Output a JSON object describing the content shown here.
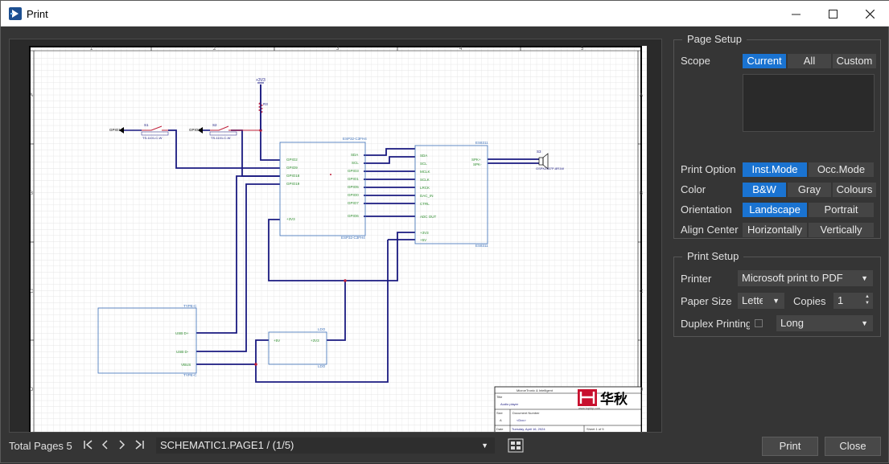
{
  "window": {
    "title": "Print"
  },
  "page_setup": {
    "title": "Page Setup",
    "scope": {
      "label": "Scope",
      "options": [
        "Current",
        "All",
        "Custom"
      ],
      "selected": "Current"
    },
    "print_option": {
      "label": "Print Option",
      "options": [
        "Inst.Mode",
        "Occ.Mode"
      ],
      "selected": "Inst.Mode"
    },
    "color": {
      "label": "Color",
      "options": [
        "B&W",
        "Gray",
        "Colours"
      ],
      "selected": "B&W"
    },
    "orientation": {
      "label": "Orientation",
      "options": [
        "Landscape",
        "Portrait"
      ],
      "selected": "Landscape"
    },
    "align_center": {
      "label": "Align Center",
      "options": [
        "Horizontally",
        "Vertically"
      ]
    }
  },
  "print_setup": {
    "title": "Print Setup",
    "printer": {
      "label": "Printer",
      "value": "Microsoft print to PDF"
    },
    "paper_size": {
      "label": "Paper Size",
      "value": "Letter"
    },
    "copies": {
      "label": "Copies",
      "value": "1"
    },
    "duplex": {
      "label": "Duplex Printing",
      "value": "Long",
      "checked": false
    }
  },
  "footer": {
    "total_pages_label": "Total Pages 5",
    "page_select": "SCHEMATIC1.PAGE1 / (1/5)",
    "print_label": "Print",
    "close_label": "Close"
  },
  "schematic": {
    "power_label": "+3V3",
    "r_label": "R3",
    "btn1_net": "GPIO1",
    "btn1_ref": "S1",
    "btn1_part": "TS-1101-C-W",
    "btn2_net": "GPIO1",
    "btn2_ref": "S2",
    "btn2_part": "TS-1101-C-W",
    "mcu_name_top": "ESP32-C3FH4",
    "mcu_name_bottom": "ESP32-C3FH4",
    "mcu_pins_left": [
      "GPIO2",
      "GPIO9",
      "GPIO18",
      "GPIO19"
    ],
    "mcu_pins_right": [
      "SDA",
      "SCL",
      "GPIO3",
      "GPIO1",
      "GPIO0",
      "GPIO5",
      "GPIO7",
      "GPIO6"
    ],
    "mcu_3v3": "+3V3",
    "codec_name": "ES8311",
    "codec_pins_left": [
      "SDA",
      "SCL",
      "MCLK",
      "SCLK",
      "LRCK",
      "DAC_IN",
      "CTRL",
      "ADC OUT"
    ],
    "codec_pins_power": [
      "+3V3",
      "+5V"
    ],
    "codec_out": [
      "SPK+",
      "SPK-"
    ],
    "speaker_ref": "S3",
    "speaker_part": "GSPK2307P-8R1W",
    "usb_name": "TYPE-C",
    "usb_pins": [
      "USB D+",
      "USB D-",
      "VBUS"
    ],
    "ldo_name": "LDO",
    "ldo_pins": [
      "+5V",
      "+3V3"
    ],
    "col_numbers": [
      "1",
      "2",
      "3",
      "4",
      "5"
    ],
    "row_letters": [
      "A",
      "B",
      "C",
      "D"
    ],
    "tb_company": "MicroeTronic & Intelligent",
    "tb_title_label": "Title",
    "tb_title": "Audio player",
    "tb_size_label": "Size",
    "tb_size": "A",
    "tb_docnum_label": "Document Number",
    "tb_docnum": "<Doc>",
    "tb_date_label": "Date",
    "tb_date": "Tuesday, April 16, 2024",
    "tb_sheet": "Sheet 1 of 5",
    "tb_logo_text": "华秋",
    "tb_logo_url": "www.hqchip.com"
  }
}
